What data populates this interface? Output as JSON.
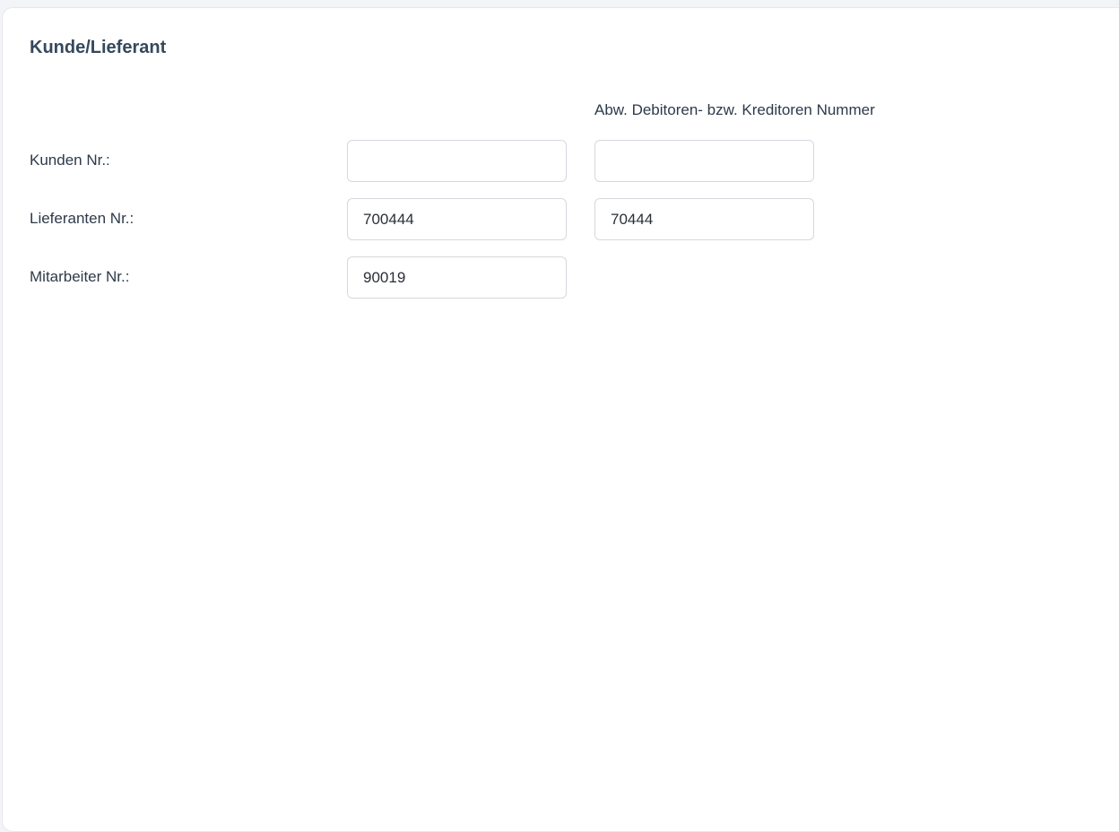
{
  "section": {
    "title": "Kunde/Lieferant",
    "column_header": "Abw. Debitoren- bzw. Kreditoren Nummer"
  },
  "rows": [
    {
      "label": "Kunden Nr.:",
      "number": "",
      "alt_number": ""
    },
    {
      "label": "Lieferanten Nr.:",
      "number": "700444",
      "alt_number": "70444"
    },
    {
      "label": "Mitarbeiter Nr.:",
      "number": "90019"
    }
  ]
}
